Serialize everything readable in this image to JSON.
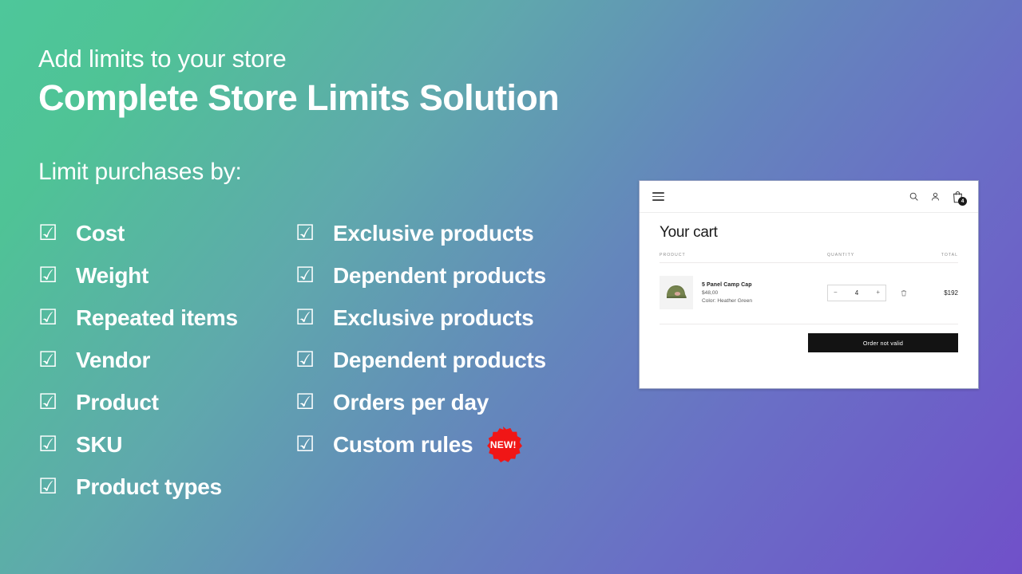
{
  "hero": {
    "eyebrow": "Add limits to your store",
    "headline": "Complete Store Limits Solution",
    "subhead": "Limit purchases by:",
    "checkbox_glyph": "☑"
  },
  "colors": {
    "gradient_start": "#4ec79a",
    "gradient_mid": "#6486bc",
    "gradient_end": "#7050c9",
    "badge_red": "#f01616",
    "text_white": "#ffffff",
    "button_black": "#131313"
  },
  "features": {
    "left_column": [
      {
        "label": "Cost"
      },
      {
        "label": "Weight"
      },
      {
        "label": "Repeated items"
      },
      {
        "label": "Vendor"
      },
      {
        "label": "Product"
      },
      {
        "label": "SKU"
      },
      {
        "label": "Product types"
      }
    ],
    "right_column": [
      {
        "label": "Exclusive products",
        "badge": ""
      },
      {
        "label": "Dependent products",
        "badge": ""
      },
      {
        "label": "Exclusive products",
        "badge": ""
      },
      {
        "label": "Dependent products",
        "badge": ""
      },
      {
        "label": "Orders per day",
        "badge": ""
      },
      {
        "label": "Custom rules",
        "badge": "NEW!"
      }
    ]
  },
  "cart": {
    "topbar": {
      "menu_icon": "hamburger-icon",
      "search_icon": "search-icon",
      "account_icon": "account-icon",
      "bag_icon": "shopping-bag-icon",
      "bag_count": "4"
    },
    "title": "Your cart",
    "columns": {
      "product": "PRODUCT",
      "quantity": "QUANTITY",
      "total": "TOTAL"
    },
    "items": [
      {
        "name": "5 Panel Camp Cap",
        "price": "$48,00",
        "variant": "Color: Heather Green",
        "decrease_label": "−",
        "quantity": "4",
        "increase_label": "+",
        "remove_icon": "trash-icon",
        "total": "$192"
      }
    ],
    "checkout_button": "Order not valid"
  }
}
